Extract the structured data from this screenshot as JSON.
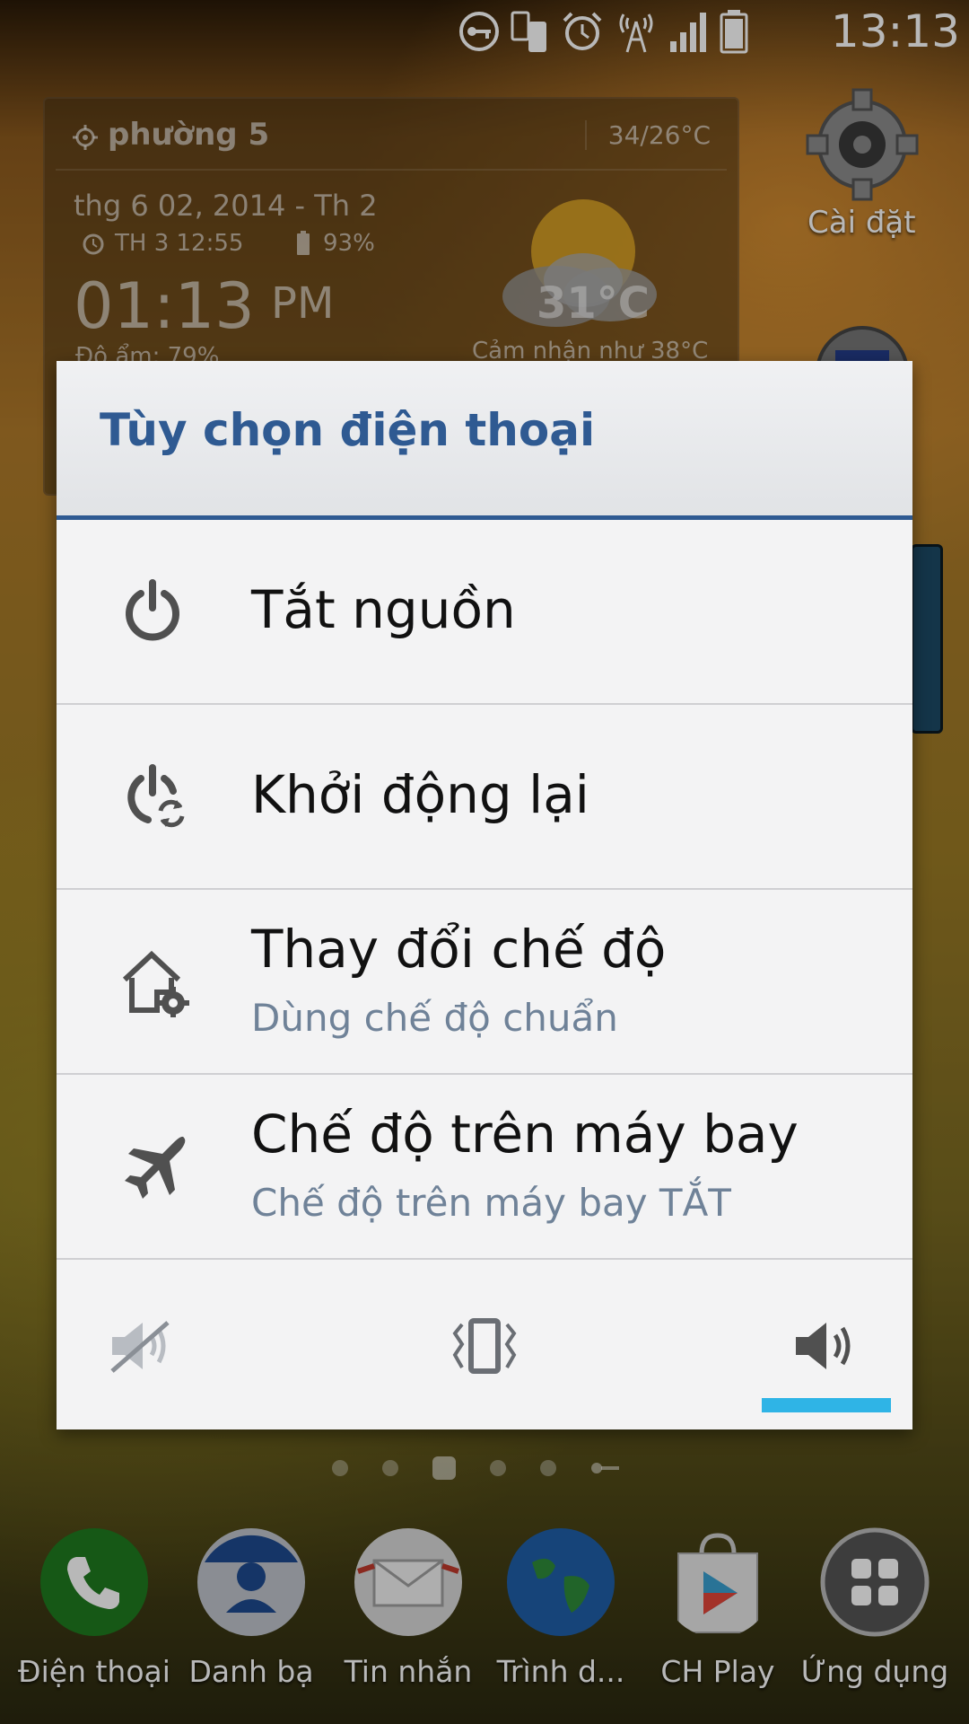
{
  "status_bar": {
    "time": "13:13",
    "icons": [
      "vpn-key-icon",
      "phone-sync-icon",
      "alarm-icon",
      "signal-tower-icon",
      "signal-bars-icon",
      "battery-icon"
    ]
  },
  "weather_widget": {
    "location": "phường 5",
    "minmax": "34/26°C",
    "date": "thg 6 02, 2014 - Th 2",
    "alarm": "TH 3 12:55",
    "battery": "93%",
    "time": "01:13",
    "ampm": "PM",
    "humidity": "Độ ẩm: 79%",
    "temperature": "31°C",
    "feels_like": "Cảm nhận như 38°C"
  },
  "home_icons": {
    "settings_label": "Cài đặt"
  },
  "dialog": {
    "title": "Tùy chọn điện thoại",
    "options": [
      {
        "label": "Tắt nguồn",
        "icon": "power-icon"
      },
      {
        "label": "Khởi động lại",
        "icon": "restart-icon"
      },
      {
        "label": "Thay đổi chế độ",
        "sub": "Dùng chế độ chuẩn",
        "icon": "home-settings-icon"
      },
      {
        "label": "Chế độ trên máy bay",
        "sub": "Chế độ trên máy bay TẮT",
        "icon": "airplane-icon"
      }
    ],
    "sound_modes": [
      "silent-icon",
      "vibrate-icon",
      "sound-on-icon"
    ],
    "selected_sound_mode": "sound-on-icon"
  },
  "dock": {
    "items": [
      {
        "label": "Điện thoại",
        "icon": "phone-icon"
      },
      {
        "label": "Danh bạ",
        "icon": "contacts-icon"
      },
      {
        "label": "Tin nhắn",
        "icon": "messages-icon"
      },
      {
        "label": "Trình d...",
        "icon": "browser-icon"
      },
      {
        "label": "CH Play",
        "icon": "play-store-icon"
      },
      {
        "label": "Ứng dụng",
        "icon": "apps-icon"
      }
    ]
  },
  "colors": {
    "dialog_title": "#2f5a92",
    "sound_indicator": "#2fb4e6",
    "subtext": "#6f8298"
  }
}
